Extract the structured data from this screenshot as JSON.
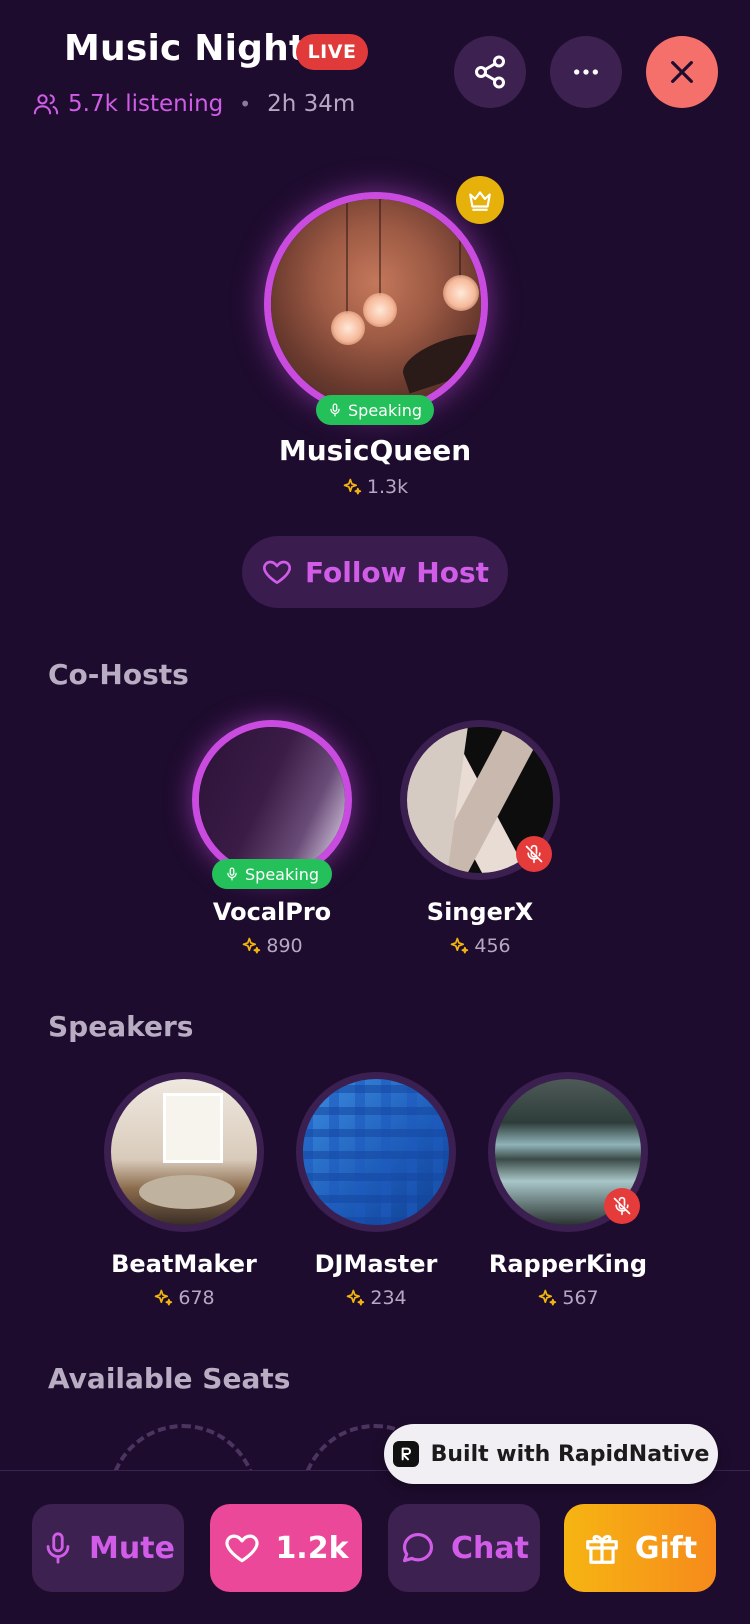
{
  "room": {
    "title": "Music Night",
    "live_label": "LIVE",
    "listeners": "5.7k listening",
    "separator": "•",
    "duration": "2h 34m"
  },
  "host": {
    "name": "MusicQueen",
    "stat": "1.3k",
    "speaking_label": "Speaking",
    "follow_label": "Follow Host"
  },
  "sections": {
    "cohosts": "Co-Hosts",
    "speakers": "Speakers",
    "available_seats": "Available Seats"
  },
  "cohosts": [
    {
      "name": "VocalPro",
      "stat": "890",
      "speaking": true,
      "speaking_label": "Speaking"
    },
    {
      "name": "SingerX",
      "stat": "456",
      "muted": true
    }
  ],
  "speakers": [
    {
      "name": "BeatMaker",
      "stat": "678"
    },
    {
      "name": "DJMaster",
      "stat": "234"
    },
    {
      "name": "RapperKing",
      "stat": "567",
      "muted": true
    }
  ],
  "bottom_bar": {
    "mute_label": "Mute",
    "like_count": "1.2k",
    "chat_label": "Chat",
    "gift_label": "Gift"
  },
  "watermark": "Built with RapidNative",
  "colors": {
    "background": "#1e0c2e",
    "accent": "#d05ce8",
    "live": "#e03a3a",
    "speaking": "#24c15a",
    "like": "#ec4899",
    "gift": "#f6b512",
    "close": "#f5706a"
  }
}
